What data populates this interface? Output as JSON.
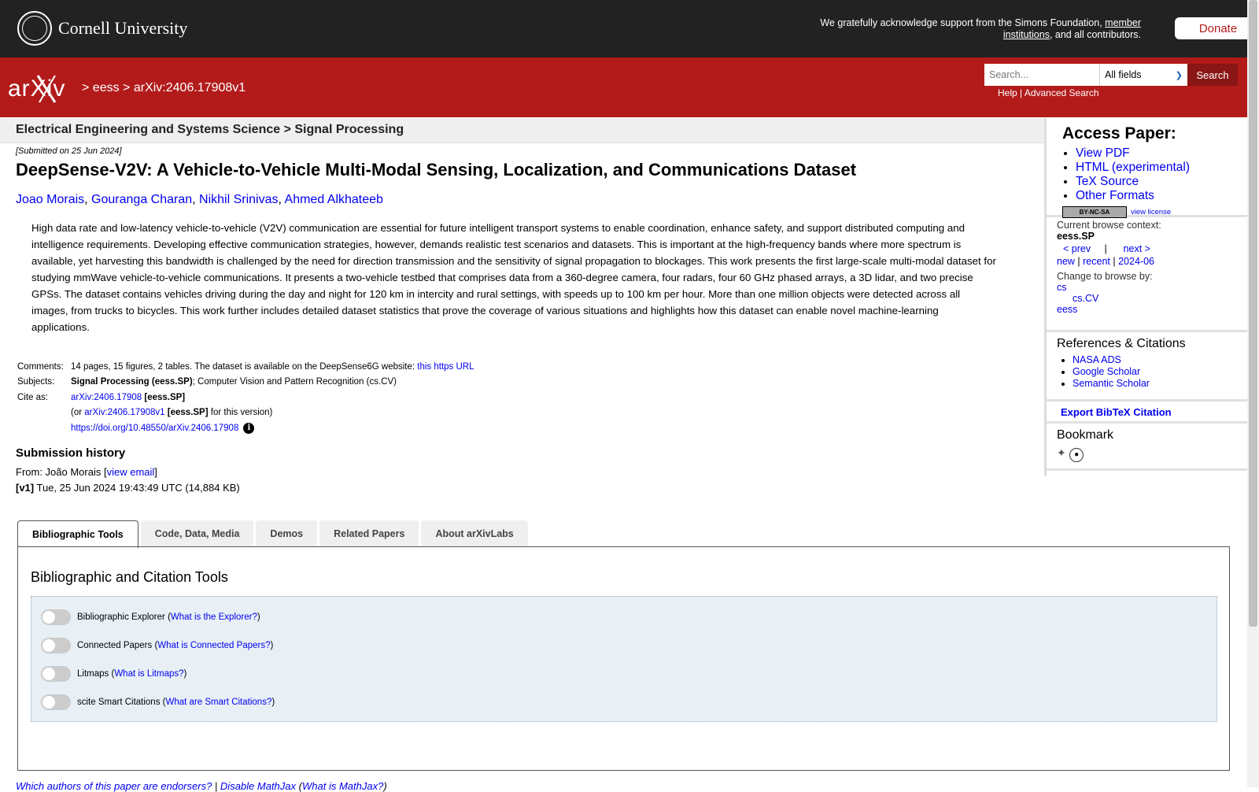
{
  "cornell": {
    "name": "Cornell University",
    "support_text": "We gratefully acknowledge support from the Simons Foundation,",
    "support_link": "member institutions",
    "support_tail": ", and all contributors.",
    "donate": "Donate"
  },
  "header": {
    "crumb_sep": ">",
    "crumb1": "eess",
    "crumb2": "arXiv:2406.17908v1",
    "search_placeholder": "Search...",
    "search_field": "All fields",
    "search_button": "Search",
    "help": "Help",
    "pipe": "|",
    "advanced": "Advanced Search"
  },
  "subject_band": "Electrical Engineering and Systems Science > Signal Processing",
  "paper": {
    "submitted": "[Submitted on 25 Jun 2024]",
    "title": "DeepSense-V2V: A Vehicle-to-Vehicle Multi-Modal Sensing, Localization, and Communications Dataset",
    "authors": [
      "Joao Morais",
      "Gouranga Charan",
      "Nikhil Srinivas",
      "Ahmed Alkhateeb"
    ],
    "abstract": "High data rate and low-latency vehicle-to-vehicle (V2V) communication are essential for future intelligent transport systems to enable coordination, enhance safety, and support distributed computing and intelligence requirements. Developing effective communication strategies, however, demands realistic test scenarios and datasets. This is important at the high-frequency bands where more spectrum is available, yet harvesting this bandwidth is challenged by the need for direction transmission and the sensitivity of signal propagation to blockages. This work presents the first large-scale multi-modal dataset for studying mmWave vehicle-to-vehicle communications. It presents a two-vehicle testbed that comprises data from a 360-degree camera, four radars, four 60 GHz phased arrays, a 3D lidar, and two precise GPSs. The dataset contains vehicles driving during the day and night for 120 km in intercity and rural settings, with speeds up to 100 km per hour. More than one million objects were detected across all images, from trucks to bicycles. This work further includes detailed dataset statistics that prove the coverage of various situations and highlights how this dataset can enable novel machine-learning applications."
  },
  "meta": {
    "comments_label": "Comments:",
    "comments": "14 pages, 15 figures, 2 tables. The dataset is available on the DeepSense6G website:",
    "comments_link": "this https URL",
    "subjects_label": "Subjects:",
    "subjects_bold": "Signal Processing (eess.SP)",
    "subjects_rest": "; Computer Vision and Pattern Recognition (cs.CV)",
    "cite_label": "Cite as:",
    "cite_id": "arXiv:2406.17908",
    "cite_tag": "[eess.SP]",
    "or_prefix": "(or",
    "or_id": "arXiv:2406.17908v1",
    "or_tag": "[eess.SP]",
    "or_suffix": "for this version)",
    "doi": "https://doi.org/10.48550/arXiv.2406.17908"
  },
  "history": {
    "title": "Submission history",
    "from_prefix": "From: João Morais [",
    "view_email": "view email",
    "from_suffix": "]",
    "v1_tag": "[v1]",
    "v1_text": "Tue, 25 Jun 2024 19:43:49 UTC (14,884 KB)"
  },
  "sidebar": {
    "access_title": "Access Paper:",
    "access_links": [
      "View PDF",
      "HTML (experimental)",
      "TeX Source",
      "Other Formats"
    ],
    "cc_badge": "BY-NC-SA",
    "view_license": "view license",
    "browse_context_label": "Current browse context:",
    "browse_context": "eess.SP",
    "prev": "< prev",
    "next": "next >",
    "new": "new",
    "recent": "recent",
    "month": "2024-06",
    "change_label": "Change to browse by:",
    "browse_cs": "cs",
    "browse_cscv": "cs.CV",
    "browse_eess": "eess",
    "refs_title": "References & Citations",
    "refs": [
      "NASA ADS",
      "Google Scholar",
      "Semantic Scholar"
    ],
    "bibtex": "Export BibTeX Citation",
    "bookmark_title": "Bookmark"
  },
  "tabs": [
    "Bibliographic Tools",
    "Code, Data, Media",
    "Demos",
    "Related Papers",
    "About arXivLabs"
  ],
  "tools": {
    "title": "Bibliographic and Citation Tools",
    "items": [
      {
        "label": "Bibliographic Explorer",
        "help": "What is the Explorer?"
      },
      {
        "label": "Connected Papers",
        "help": "What is Connected Papers?"
      },
      {
        "label": "Litmaps",
        "help": "What is Litmaps?"
      },
      {
        "label": "scite Smart Citations",
        "help": "What are Smart Citations?"
      }
    ]
  },
  "footer": {
    "endorsers": "Which authors of this paper are endorsers?",
    "mathjax": "Disable MathJax",
    "what_mathjax": "What is MathJax?"
  }
}
